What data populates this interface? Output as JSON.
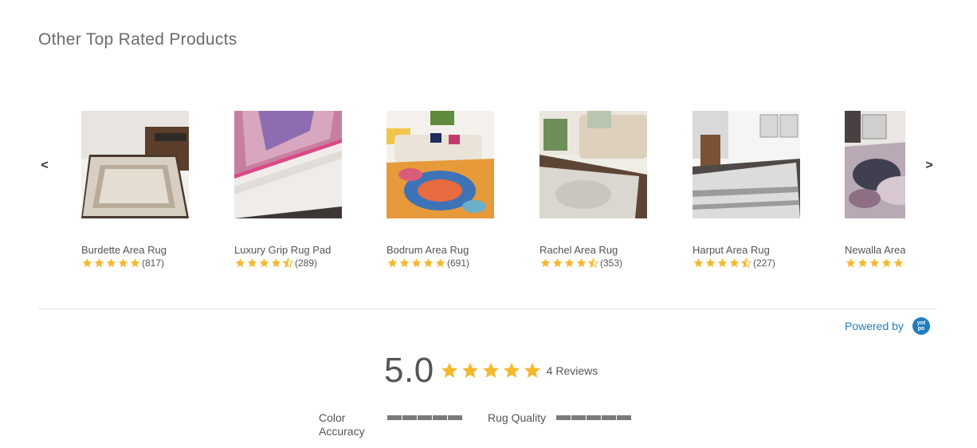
{
  "section_title": "Other Top Rated Products",
  "navigation": {
    "prev_icon": "<",
    "next_icon": ">"
  },
  "products": [
    {
      "name": "Burdette Area Rug",
      "rating": 5,
      "count": "(817)",
      "image": "beige-bordered-rug"
    },
    {
      "name": "Luxury Grip Rug Pad",
      "rating": 4.5,
      "count": "(289)",
      "image": "rug-pad-corner"
    },
    {
      "name": "Bodrum Area Rug",
      "rating": 5,
      "count": "(691)",
      "image": "colorful-living-room-rug"
    },
    {
      "name": "Rachel Area Rug",
      "rating": 4.5,
      "count": "(353)",
      "image": "cream-sofa-rug"
    },
    {
      "name": "Harput Area Rug",
      "rating": 4.5,
      "count": "(227)",
      "image": "gray-striped-rug"
    },
    {
      "name": "Newalla Area Rug",
      "rating": 5,
      "count": "",
      "image": "abstract-rug"
    }
  ],
  "powered_by": {
    "label": "Powered by",
    "logo_text": "yot po"
  },
  "summary": {
    "score": "5.0",
    "rating": 5,
    "reviews": "4 Reviews"
  },
  "factors": [
    {
      "label": "Color Accuracy",
      "segments": 5
    },
    {
      "label": "Rug Quality",
      "segments": 5
    }
  ],
  "colors": {
    "star": "#f5b82e",
    "link": "#1f7ec1",
    "text": "#555555"
  }
}
